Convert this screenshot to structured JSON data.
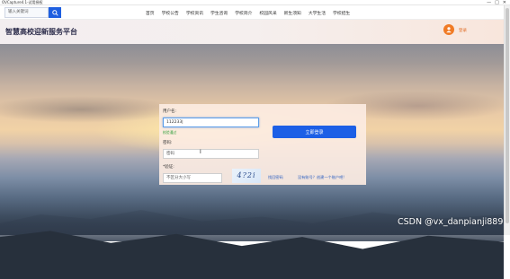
{
  "window": {
    "title": "OVCapture4.1-试用授权",
    "controls": [
      "—",
      "□",
      "✕"
    ]
  },
  "navbar": {
    "search_placeholder": "输入关键词",
    "links": [
      "首页",
      "学校公告",
      "学校资讯",
      "学生咨询",
      "学校简介",
      "校园风采",
      "新生须知",
      "大学生活",
      "学校招生"
    ]
  },
  "header": {
    "site_title": "智慧高校迎新服务平台",
    "login_label": "登录"
  },
  "login_form": {
    "username_label": "用户名:",
    "username_value": "112233|",
    "username_hint": "校验通过",
    "password_label": "密码:",
    "password_placeholder": "密码",
    "captcha_label": "*验证:",
    "captcha_placeholder": "不区分大小写",
    "captcha_text": "4?2i",
    "submit_label": "立即登录",
    "forgot_label": "找回密码",
    "register_label": "没有账号？创建一个账户吧!"
  },
  "watermark": "CSDN @vx_danpianji889"
}
